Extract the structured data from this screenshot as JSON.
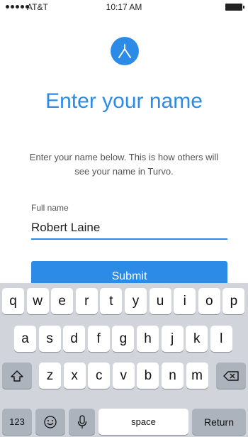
{
  "status_bar": {
    "carrier": "AT&T",
    "time": "10:17 AM"
  },
  "main": {
    "title": "Enter your name",
    "subtitle": "Enter your name below.  This is how others will see your name in Turvo.",
    "field_label": "Full name",
    "field_value": "Robert Laine",
    "submit_label": "Submit"
  },
  "keyboard": {
    "row1": [
      "q",
      "w",
      "e",
      "r",
      "t",
      "y",
      "u",
      "i",
      "o",
      "p"
    ],
    "row2": [
      "a",
      "s",
      "d",
      "f",
      "g",
      "h",
      "j",
      "k",
      "l"
    ],
    "row3": [
      "z",
      "x",
      "c",
      "v",
      "b",
      "n",
      "m"
    ],
    "numbers_label": "123",
    "space_label": "space",
    "return_label": "Return",
    "icons": {
      "shift": "shift-icon",
      "backspace": "backspace-icon",
      "emoji": "emoji-icon",
      "mic": "microphone-icon"
    }
  },
  "colors": {
    "accent": "#2b8be6",
    "keyboard_bg": "#d1d5db",
    "special_key": "#acb3bc"
  }
}
